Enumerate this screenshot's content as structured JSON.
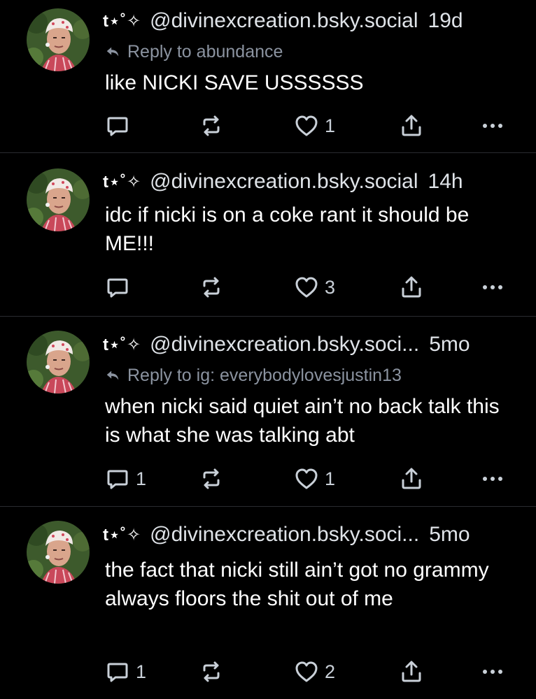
{
  "posts": [
    {
      "display_name": "t⋆˚✧",
      "handle": "@divinexcreation.bsky.social",
      "time": "19d",
      "reply_prefix": "Reply to",
      "reply_to": "abundance",
      "text": "like NICKI SAVE USSSSSS",
      "reply_count": "",
      "repost_count": "",
      "like_count": "1"
    },
    {
      "display_name": "t⋆˚✧",
      "handle": "@divinexcreation.bsky.social",
      "time": "14h",
      "reply_prefix": "",
      "reply_to": "",
      "text": "idc if nicki is on a coke rant it should be ME!!!",
      "reply_count": "",
      "repost_count": "",
      "like_count": "3"
    },
    {
      "display_name": "t⋆˚✧",
      "handle": "@divinexcreation.bsky.soci...",
      "time": "5mo",
      "reply_prefix": "Reply to",
      "reply_to": "ig: everybodylovesjustin13",
      "text": "when nicki said quiet ain’t no back talk this is what she was talking abt",
      "reply_count": "1",
      "repost_count": "",
      "like_count": "1"
    },
    {
      "display_name": "t⋆˚✧",
      "handle": "@divinexcreation.bsky.soci...",
      "time": "5mo",
      "reply_prefix": "",
      "reply_to": "",
      "text": "the fact that nicki still ain’t got no grammy always floors the shit out of me",
      "reply_count": "1",
      "repost_count": "",
      "like_count": "2"
    }
  ],
  "icons": {
    "reply": "speech-bubble-icon",
    "repost": "repost-icon",
    "like": "heart-icon",
    "share": "share-icon",
    "more": "ellipsis-icon",
    "reply_arrow": "reply-arrow-icon"
  },
  "colors": {
    "background": "#000000",
    "text": "#ffffff",
    "muted": "#8b93a0",
    "divider": "#2a2c30"
  }
}
